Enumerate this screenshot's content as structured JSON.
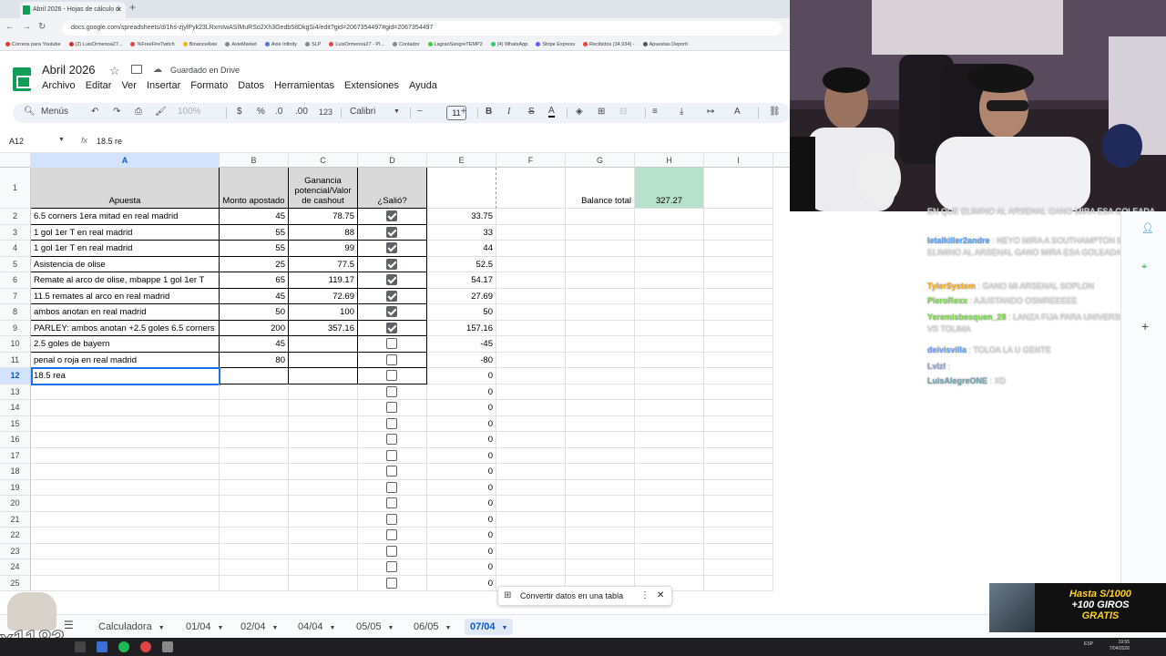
{
  "browser": {
    "tab_title": "Abril 2026 - Hojas de cálculo d",
    "url": "docs.google.com/spreadsheets/d/1hs-zjylPyk23LRxmIwASIMuRSo2Xh3Gedb58DkgSi4/edit?gid=2067354497#gid=2067354497",
    "bookmarks": [
      "Correos para Youtube",
      "(2) LuisOrmenoa27...",
      "%FreeFireTwitch",
      "BinanceAxie",
      "AxieMarket",
      "Axie Infinity",
      "SLP",
      "LuisOrmenoa27 - Pl...",
      "Contador",
      "LagranSangreTEMP2",
      "(4) WhatsApp",
      "Stripe Express",
      "Recibidos (34,934) -",
      "Apuestas Deporti"
    ]
  },
  "doc": {
    "title": "Abril 2026",
    "saved_status": "Guardado en Drive",
    "menu": [
      "Archivo",
      "Editar",
      "Ver",
      "Insertar",
      "Formato",
      "Datos",
      "Herramientas",
      "Extensiones",
      "Ayuda"
    ]
  },
  "toolbar": {
    "menus_label": "Menús",
    "zoom": "100%",
    "currency": "$",
    "percent": "%",
    "dec_less": ".0",
    "dec_more": ".00",
    "num_format": "123",
    "font": "Calibri",
    "font_size": "11",
    "bold": "B",
    "italic": "I",
    "strike": "S",
    "text_color": "A"
  },
  "formula_bar": {
    "name_box": "A12",
    "fx": "fx",
    "value": "18.5 re"
  },
  "grid": {
    "columns": [
      "A",
      "B",
      "C",
      "D",
      "E",
      "F",
      "G",
      "H",
      "I"
    ],
    "headers": {
      "a": "Apuesta",
      "b": "Monto apostado",
      "c": "Ganancia potencial/Valor de cashout",
      "d": "¿Salió?"
    },
    "balance_label": "Balance total",
    "balance_value": "327.27",
    "rows": [
      {
        "n": "2",
        "a": "6.5 corners 1era mitad en real madrid",
        "b": "45",
        "c": "78.75",
        "d": true,
        "e": "33.75"
      },
      {
        "n": "3",
        "a": "1 gol 1er T en real madrid",
        "b": "55",
        "c": "88",
        "d": true,
        "e": "33"
      },
      {
        "n": "4",
        "a": "1 gol 1er T en real madrid",
        "b": "55",
        "c": "99",
        "d": true,
        "e": "44"
      },
      {
        "n": "5",
        "a": "Asistencia de olise",
        "b": "25",
        "c": "77.5",
        "d": true,
        "e": "52.5"
      },
      {
        "n": "6",
        "a": "Remate al arco de olise, mbappe 1 gol 1er T",
        "b": "65",
        "c": "119.17",
        "d": true,
        "e": "54.17"
      },
      {
        "n": "7",
        "a": "11.5 remates al arco en real madrid",
        "b": "45",
        "c": "72.69",
        "d": true,
        "e": "27.69"
      },
      {
        "n": "8",
        "a": "ambos anotan en real madrid",
        "b": "50",
        "c": "100",
        "d": true,
        "e": "50"
      },
      {
        "n": "9",
        "a": "PARLEY: ambos anotan +2.5 goles 6.5 corners",
        "b": "200",
        "c": "357.16",
        "d": true,
        "e": "157.16"
      },
      {
        "n": "10",
        "a": "2.5 goles de bayern",
        "b": "45",
        "c": "",
        "d": false,
        "e": "-45"
      },
      {
        "n": "11",
        "a": "penal o roja en real madrid",
        "b": "80",
        "c": "",
        "d": false,
        "e": "-80"
      },
      {
        "n": "12",
        "a": "18.5 rea",
        "b": "",
        "c": "",
        "d": false,
        "e": "0"
      },
      {
        "n": "13",
        "a": "",
        "b": "",
        "c": "",
        "d": false,
        "e": "0"
      },
      {
        "n": "14",
        "a": "",
        "b": "",
        "c": "",
        "d": false,
        "e": "0"
      },
      {
        "n": "15",
        "a": "",
        "b": "",
        "c": "",
        "d": false,
        "e": "0"
      },
      {
        "n": "16",
        "a": "",
        "b": "",
        "c": "",
        "d": false,
        "e": "0"
      },
      {
        "n": "17",
        "a": "",
        "b": "",
        "c": "",
        "d": false,
        "e": "0"
      },
      {
        "n": "18",
        "a": "",
        "b": "",
        "c": "",
        "d": false,
        "e": "0"
      },
      {
        "n": "19",
        "a": "",
        "b": "",
        "c": "",
        "d": false,
        "e": "0"
      },
      {
        "n": "20",
        "a": "",
        "b": "",
        "c": "",
        "d": false,
        "e": "0"
      },
      {
        "n": "21",
        "a": "",
        "b": "",
        "c": "",
        "d": false,
        "e": "0"
      },
      {
        "n": "22",
        "a": "",
        "b": "",
        "c": "",
        "d": false,
        "e": "0"
      },
      {
        "n": "23",
        "a": "",
        "b": "",
        "c": "",
        "d": false,
        "e": "0"
      },
      {
        "n": "24",
        "a": "",
        "b": "",
        "c": "",
        "d": false,
        "e": "0"
      },
      {
        "n": "25",
        "a": "",
        "b": "",
        "c": "",
        "d": false,
        "e": "0"
      }
    ]
  },
  "convert_prompt": "Convertir datos en una tabla",
  "sheet_tabs": [
    "Calculadora",
    "01/04",
    "02/04",
    "04/04",
    "05/05",
    "06/05",
    "07/04"
  ],
  "active_sheet": "07/04",
  "chat": [
    {
      "user": "",
      "text": "EN QUE ELIMINO AL ARSENAL GANO MIRA ESA GOLEADA"
    },
    {
      "user": "letalkiller2andre",
      "text": "NEYO MIRA A SOUTHAMPTON EN QUE ELIMINO AL ARSENAL GANO MIRA ESA GOLEADA"
    },
    {
      "user": "TylerSystem",
      "text": "GANO MI ARSENAL SOPLON"
    },
    {
      "user": "PieroRexx",
      "text": "AJUSTANDO OSMREEEEE"
    },
    {
      "user": "Yeremisbesquen_28",
      "text": "LANZA FIJA PARA UNIVERSITARIO VS TOLIMA"
    },
    {
      "user": "deivisvilla",
      "text": "TOLOA LA U GENTE"
    },
    {
      "user": "Lvlzl",
      "text": ""
    },
    {
      "user": "LuisAlegreONE",
      "text": "XD"
    }
  ],
  "promo": {
    "line1": "Hasta S/1000",
    "line2": "+100 GIROS",
    "line3": "GRATIS"
  },
  "overlay_counter": "x1183",
  "taskbar": {
    "lang": "ESP",
    "time": "19:55",
    "date": "7/04/2026"
  },
  "colors": {
    "accent": "#1a73e8",
    "header_gray": "#d9d9d9",
    "balance_green": "#b7e1cd",
    "sheets_green": "#0f9d58",
    "promo_yellow": "#ffd21a"
  }
}
